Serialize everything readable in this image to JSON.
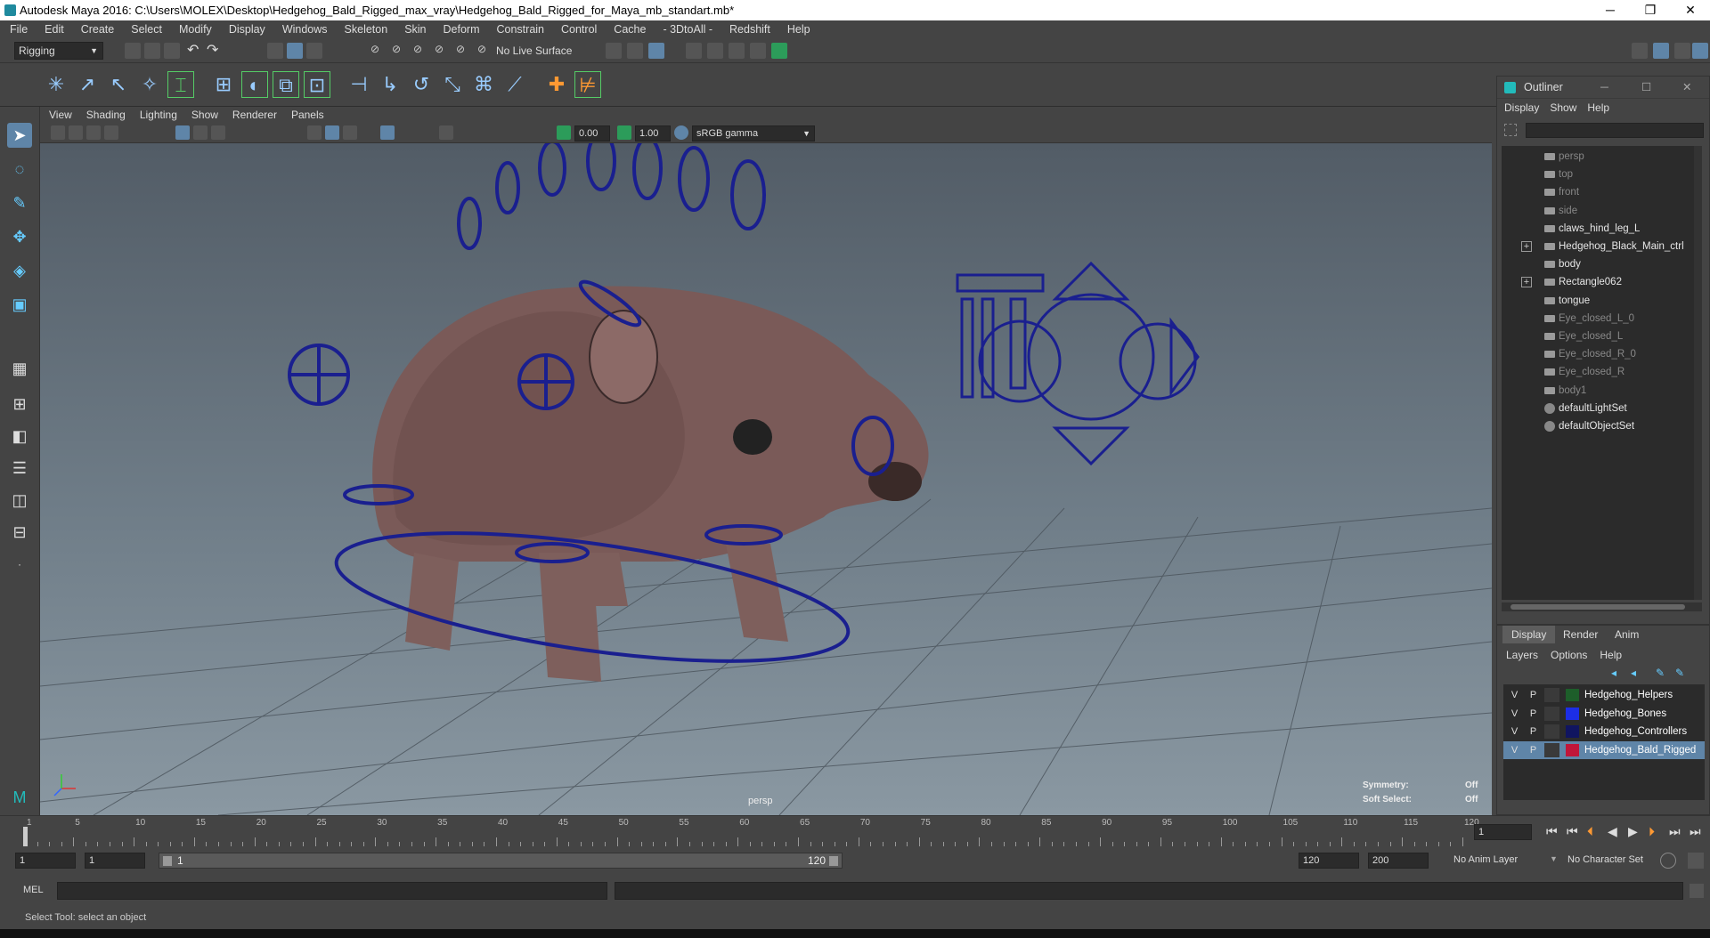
{
  "window": {
    "title": "Autodesk Maya 2016: C:\\Users\\MOLEX\\Desktop\\Hedgehog_Bald_Rigged_max_vray\\Hedgehog_Bald_Rigged_for_Maya_mb_standart.mb*"
  },
  "menubar": [
    "File",
    "Edit",
    "Create",
    "Select",
    "Modify",
    "Display",
    "Windows",
    "Skeleton",
    "Skin",
    "Deform",
    "Constrain",
    "Control",
    "Cache",
    "- 3DtoAll -",
    "Redshift",
    "Help"
  ],
  "shelf": {
    "mode": "Rigging",
    "live_surface": "No Live Surface"
  },
  "viewport": {
    "menu": [
      "View",
      "Shading",
      "Lighting",
      "Show",
      "Renderer",
      "Panels"
    ],
    "exposure": "0.00",
    "gamma": "1.00",
    "color_space": "sRGB gamma",
    "camera": "persp",
    "symmetry_label": "Symmetry:",
    "symmetry_value": "Off",
    "soft_select_label": "Soft Select:",
    "soft_select_value": "Off",
    "wire_color": "#1a1f8f"
  },
  "outliner": {
    "title": "Outliner",
    "menu": [
      "Display",
      "Show",
      "Help"
    ],
    "items": [
      {
        "label": "persp",
        "dim": true,
        "icon": "camera-icon",
        "expand": false
      },
      {
        "label": "top",
        "dim": true,
        "icon": "camera-icon",
        "expand": false
      },
      {
        "label": "front",
        "dim": true,
        "icon": "camera-icon",
        "expand": false
      },
      {
        "label": "side",
        "dim": true,
        "icon": "camera-icon",
        "expand": false
      },
      {
        "label": "claws_hind_leg_L",
        "dim": false,
        "icon": "mesh-icon",
        "expand": false
      },
      {
        "label": "Hedgehog_Black_Main_ctrl",
        "dim": false,
        "icon": "mesh-icon",
        "expand": true
      },
      {
        "label": "body",
        "dim": false,
        "icon": "mesh-icon",
        "expand": false
      },
      {
        "label": "Rectangle062",
        "dim": false,
        "icon": "mesh-icon",
        "expand": true
      },
      {
        "label": "tongue",
        "dim": false,
        "icon": "mesh-icon",
        "expand": false
      },
      {
        "label": "Eye_closed_L_0",
        "dim": true,
        "icon": "mesh-icon",
        "expand": false
      },
      {
        "label": "Eye_closed_L",
        "dim": true,
        "icon": "mesh-icon",
        "expand": false
      },
      {
        "label": "Eye_closed_R_0",
        "dim": true,
        "icon": "mesh-icon",
        "expand": false
      },
      {
        "label": "Eye_closed_R",
        "dim": true,
        "icon": "mesh-icon",
        "expand": false
      },
      {
        "label": "body1",
        "dim": true,
        "icon": "mesh-icon",
        "expand": false
      },
      {
        "label": "defaultLightSet",
        "dim": false,
        "icon": "set-icon",
        "expand": false
      },
      {
        "label": "defaultObjectSet",
        "dim": false,
        "icon": "set-icon",
        "expand": false
      }
    ]
  },
  "layers": {
    "tabs": [
      "Display",
      "Render",
      "Anim"
    ],
    "menu": [
      "Layers",
      "Options",
      "Help"
    ],
    "rows": [
      {
        "v": "V",
        "p": "P",
        "color": "#1d5e2a",
        "name": "Hedgehog_Helpers",
        "selected": false
      },
      {
        "v": "V",
        "p": "P",
        "color": "#1c2ee6",
        "name": "Hedgehog_Bones",
        "selected": false
      },
      {
        "v": "V",
        "p": "P",
        "color": "#101560",
        "name": "Hedgehog_Controllers",
        "selected": false
      },
      {
        "v": "V",
        "p": "P",
        "color": "#c0163a",
        "name": "Hedgehog_Bald_Rigged",
        "selected": true
      }
    ]
  },
  "timeline": {
    "ticks": [
      "1",
      "5",
      "10",
      "15",
      "20",
      "25",
      "30",
      "35",
      "40",
      "45",
      "50",
      "55",
      "60",
      "65",
      "70",
      "75",
      "80",
      "85",
      "90",
      "95",
      "100",
      "105",
      "110",
      "115",
      "120"
    ],
    "current_frame": "1"
  },
  "range": {
    "start": "1",
    "playback_start": "1",
    "slider_start": "1",
    "slider_end": "120",
    "playback_end": "120",
    "end": "200",
    "anim_layer": "No Anim Layer",
    "character_set": "No Character Set"
  },
  "mel": {
    "label": "MEL"
  },
  "status": {
    "text": "Select Tool: select an object"
  }
}
